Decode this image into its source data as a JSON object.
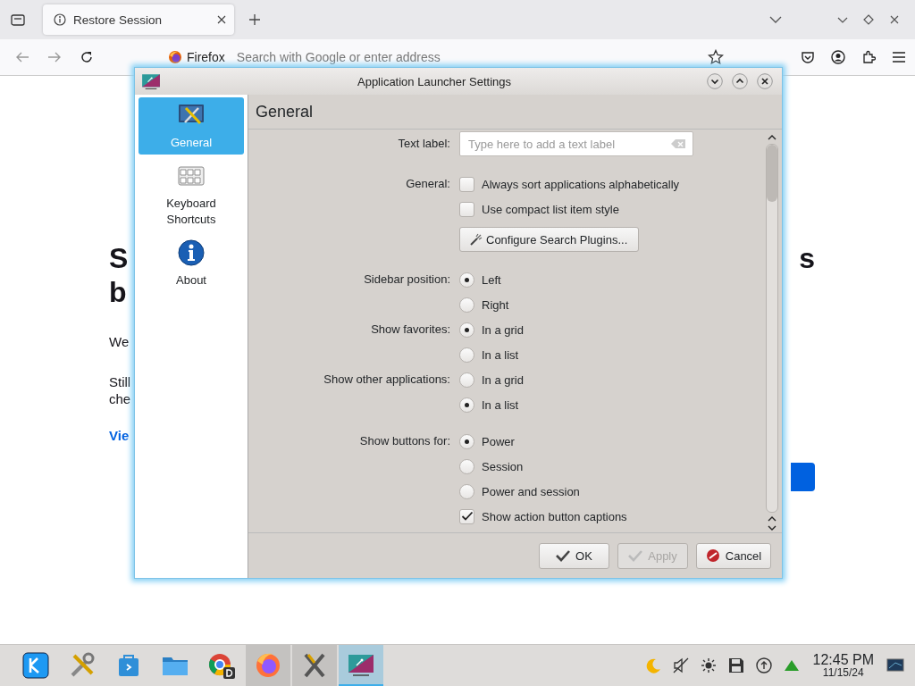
{
  "browser": {
    "tabs": [
      {
        "label": "Restore Session",
        "selected": true
      }
    ],
    "address": {
      "site": "Firefox",
      "placeholder": "Search with Google or enter address"
    }
  },
  "page": {
    "heading_lines": [
      "S",
      "b"
    ],
    "heading_right": "s",
    "paragraphs": [
      "We",
      "Still",
      "che"
    ],
    "link": "Vie"
  },
  "dialog": {
    "title": "Application Launcher Settings",
    "sidebar": [
      {
        "label": "General",
        "selected": true
      },
      {
        "label": "Keyboard Shortcuts",
        "selected": false
      },
      {
        "label": "About",
        "selected": false
      }
    ],
    "page_title": "General",
    "groups": [
      {
        "rows": [
          {
            "kind": "text",
            "label": "Text label:",
            "placeholder": "Type here to add a text label"
          }
        ]
      },
      {
        "rows": [
          {
            "kind": "checkbox",
            "label": "General:",
            "text": "Always sort applications alphabetically",
            "checked": false
          },
          {
            "kind": "checkbox",
            "text": "Use compact list item style",
            "checked": false
          },
          {
            "kind": "button",
            "text": "Configure Search Plugins..."
          }
        ]
      },
      {
        "rows": [
          {
            "kind": "radio",
            "label": "Sidebar position:",
            "text": "Left",
            "selected": true
          },
          {
            "kind": "radio",
            "text": "Right",
            "selected": false
          },
          {
            "kind": "radio",
            "label": "Show favorites:",
            "text": "In a grid",
            "selected": true
          },
          {
            "kind": "radio",
            "text": "In a list",
            "selected": false
          },
          {
            "kind": "radio",
            "label": "Show other applications:",
            "text": "In a grid",
            "selected": false
          },
          {
            "kind": "radio",
            "text": "In a list",
            "selected": true
          }
        ]
      },
      {
        "rows": [
          {
            "kind": "radio",
            "label": "Show buttons for:",
            "text": "Power",
            "selected": true
          },
          {
            "kind": "radio",
            "text": "Session",
            "selected": false
          },
          {
            "kind": "radio",
            "text": "Power and session",
            "selected": false
          },
          {
            "kind": "checkbox",
            "text": "Show action button captions",
            "checked": true
          }
        ]
      }
    ],
    "buttons": [
      {
        "kind": "ok",
        "label": "OK",
        "disabled": false
      },
      {
        "kind": "apply",
        "label": "Apply",
        "disabled": true
      },
      {
        "kind": "cancel",
        "label": "Cancel",
        "disabled": false
      }
    ]
  },
  "taskbar": {
    "apps": [
      {
        "kind": "kde",
        "running": false,
        "selected": false
      },
      {
        "kind": "tools",
        "running": false,
        "selected": false
      },
      {
        "kind": "store",
        "running": false,
        "selected": false
      },
      {
        "kind": "folder",
        "running": false,
        "selected": false
      },
      {
        "kind": "chrome",
        "running": false,
        "selected": false
      },
      {
        "kind": "firefox",
        "running": true,
        "selected": false
      },
      {
        "kind": "xterm",
        "running": true,
        "selected": false
      },
      {
        "kind": "launcher",
        "running": true,
        "selected": true
      }
    ],
    "clock": {
      "time": "12:45 PM",
      "date": "11/15/24"
    }
  }
}
